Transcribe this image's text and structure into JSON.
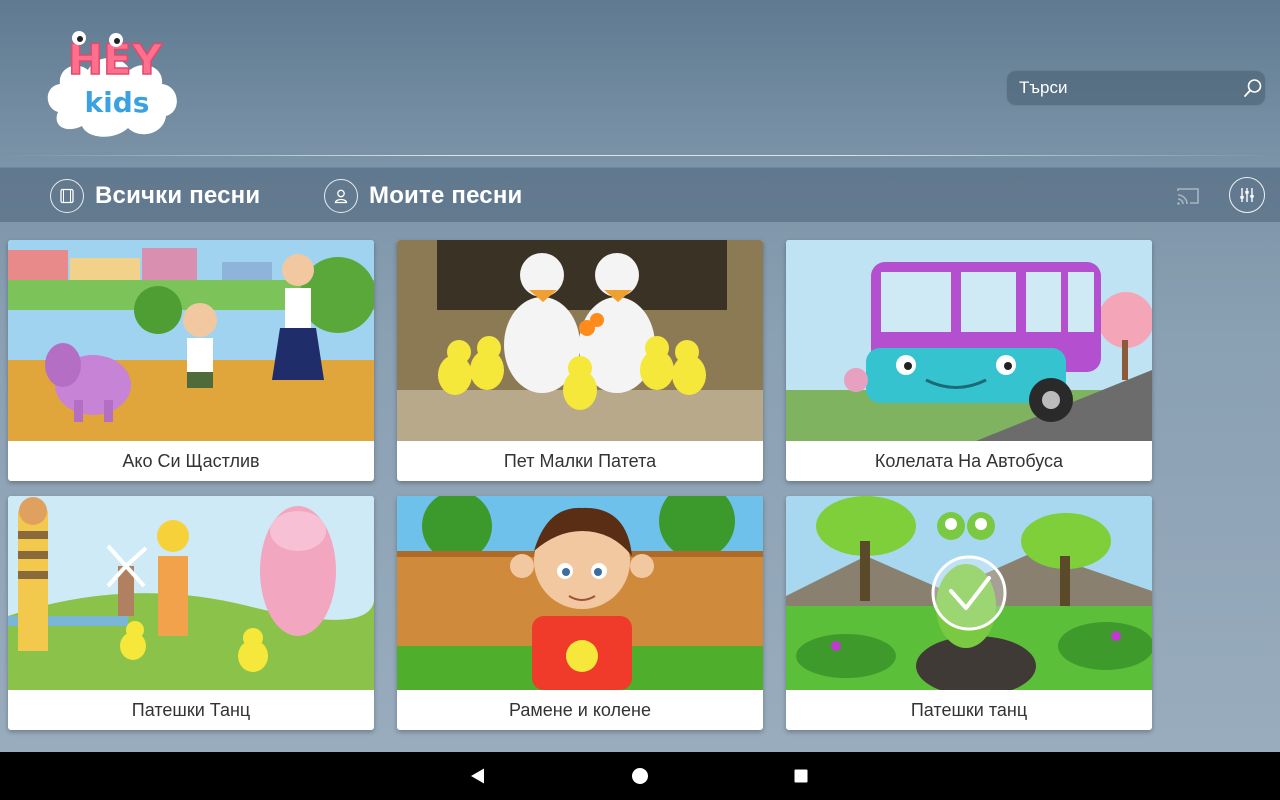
{
  "app": {
    "logo": {
      "top_text": "HEY",
      "bottom_text": "kids"
    },
    "search": {
      "placeholder": "Търси",
      "icon": "search-icon"
    }
  },
  "tabs": [
    {
      "label": "Всички песни",
      "icon": "film-icon",
      "active": true
    },
    {
      "label": "Моите песни",
      "icon": "user-icon",
      "active": false
    }
  ],
  "toolbar": {
    "cast_icon": "cast-icon",
    "settings_icon": "equalizer-icon"
  },
  "songs": [
    {
      "title": "Ако Си Щастлив",
      "thumbnail": "children-and-elephant"
    },
    {
      "title": "Пет Малки Патета",
      "thumbnail": "ducks-and-ducklings"
    },
    {
      "title": "Колелата На Автобуса",
      "thumbnail": "purple-bus"
    },
    {
      "title": "Патешки Танц",
      "thumbnail": "kids-pig-ducklings"
    },
    {
      "title": "Рамене и колене",
      "thumbnail": "boy-head-shoulders"
    },
    {
      "title": "Патешки танц",
      "thumbnail": "frog-with-guitar",
      "downloaded": true
    }
  ],
  "navbar": {
    "back_icon": "back-triangle-icon",
    "home_icon": "home-circle-icon",
    "recents_icon": "recents-square-icon"
  },
  "colors": {
    "header_bg": "#5f7a91",
    "tabbar_bg": "#4b6278",
    "card_bg": "#ffffff",
    "caption_text": "#333333"
  }
}
